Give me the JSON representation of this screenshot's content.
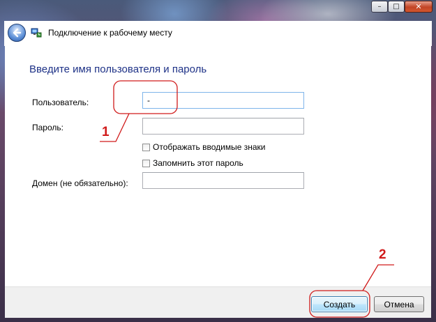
{
  "window": {
    "title": "Подключение к рабочему месту",
    "controls": {
      "minimize": "–",
      "maximize": "□",
      "close": "✕"
    },
    "back_icon": "back-arrow-icon",
    "app_icon": "network-workplace-icon"
  },
  "form": {
    "heading": "Введите имя пользователя и пароль",
    "username_label": "Пользователь:",
    "username_value": "-",
    "password_label": "Пароль:",
    "password_value": "",
    "show_chars_label": "Отображать вводимые знаки",
    "show_chars_checked": false,
    "remember_label": "Запомнить этот пароль",
    "remember_checked": false,
    "domain_label": "Домен (не обязательно):",
    "domain_value": ""
  },
  "footer": {
    "create_label": "Создать",
    "cancel_label": "Отмена"
  },
  "annotations": {
    "callout_1": "1",
    "callout_2": "2",
    "color": "#d01a1a"
  }
}
